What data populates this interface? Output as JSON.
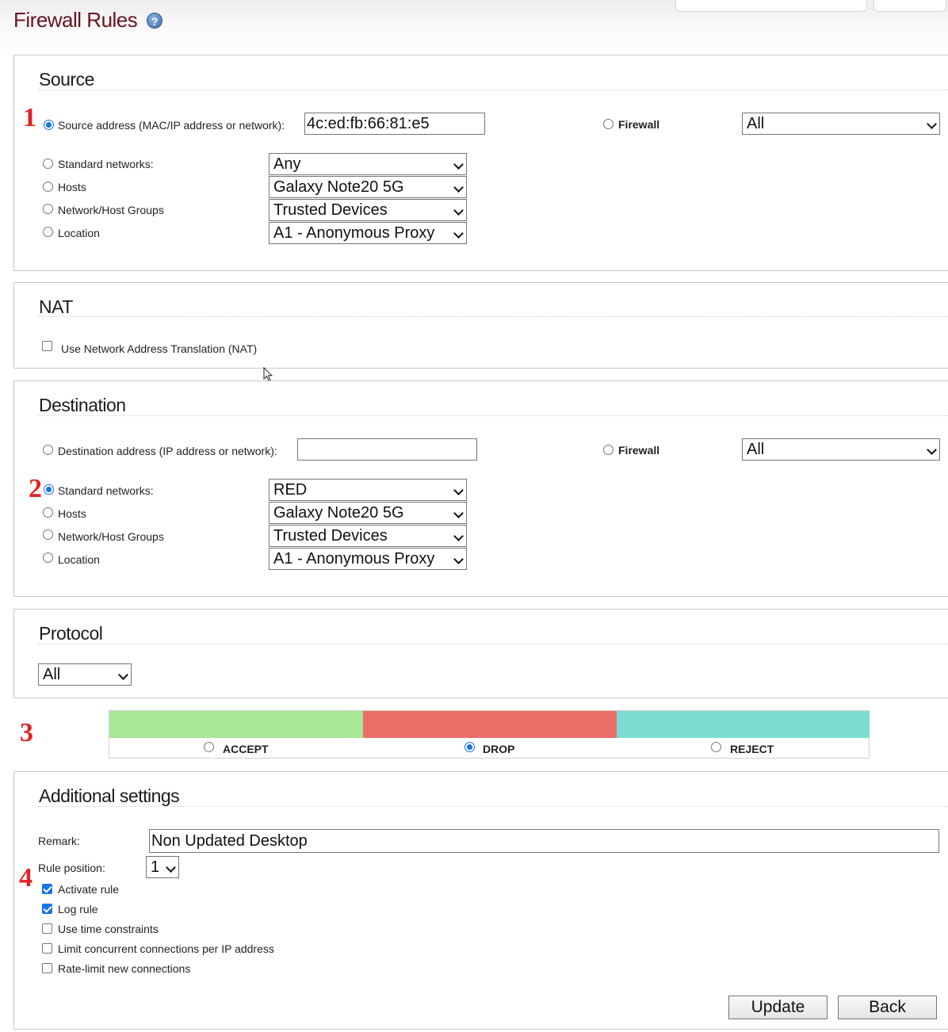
{
  "colors": {
    "title": "#6b1220",
    "marker": "#e02424",
    "accept": "#a8e796",
    "drop": "#ec6e68",
    "reject": "#7cdccf",
    "accent": "#1a73e8"
  },
  "page": {
    "title": "Firewall Rules",
    "help_icon": "question-mark-icon",
    "help_glyph": "?"
  },
  "markers": [
    "1",
    "2",
    "3",
    "4"
  ],
  "source": {
    "title": "Source",
    "address_label": "Source address (MAC/IP address or network):",
    "address_value": "4c:ed:fb:66:81:e5",
    "address_selected": true,
    "firewall_label": "Firewall",
    "firewall_value": "All",
    "standard_label": "Standard networks:",
    "standard_value": "Any",
    "hosts_label": "Hosts",
    "hosts_value": "Galaxy Note20 5G",
    "groups_label": "Network/Host Groups",
    "groups_value": "Trusted Devices",
    "location_label": "Location",
    "location_value": "A1 - Anonymous Proxy"
  },
  "nat": {
    "title": "NAT",
    "checkbox_label": "Use Network Address Translation (NAT)",
    "checked": false
  },
  "destination": {
    "title": "Destination",
    "address_label": "Destination address (IP address or network):",
    "address_value": "",
    "firewall_label": "Firewall",
    "firewall_value": "All",
    "standard_label": "Standard networks:",
    "standard_value": "RED",
    "standard_selected": true,
    "hosts_label": "Hosts",
    "hosts_value": "Galaxy Note20 5G",
    "groups_label": "Network/Host Groups",
    "groups_value": "Trusted Devices",
    "location_label": "Location",
    "location_value": "A1 - Anonymous Proxy"
  },
  "protocol": {
    "title": "Protocol",
    "value": "All"
  },
  "action": {
    "accept_label": "ACCEPT",
    "drop_label": "DROP",
    "reject_label": "REJECT",
    "selected": "DROP"
  },
  "additional": {
    "title": "Additional settings",
    "remark_label": "Remark:",
    "remark_value": "Non Updated Desktop",
    "position_label": "Rule position:",
    "position_value": "1",
    "activate_label": "Activate rule",
    "activate_checked": true,
    "log_label": "Log rule",
    "log_checked": true,
    "time_label": "Use time constraints",
    "time_checked": false,
    "limit_label": "Limit concurrent connections per IP address",
    "limit_checked": false,
    "rate_label": "Rate-limit new connections",
    "rate_checked": false
  },
  "buttons": {
    "update": "Update",
    "back": "Back"
  }
}
